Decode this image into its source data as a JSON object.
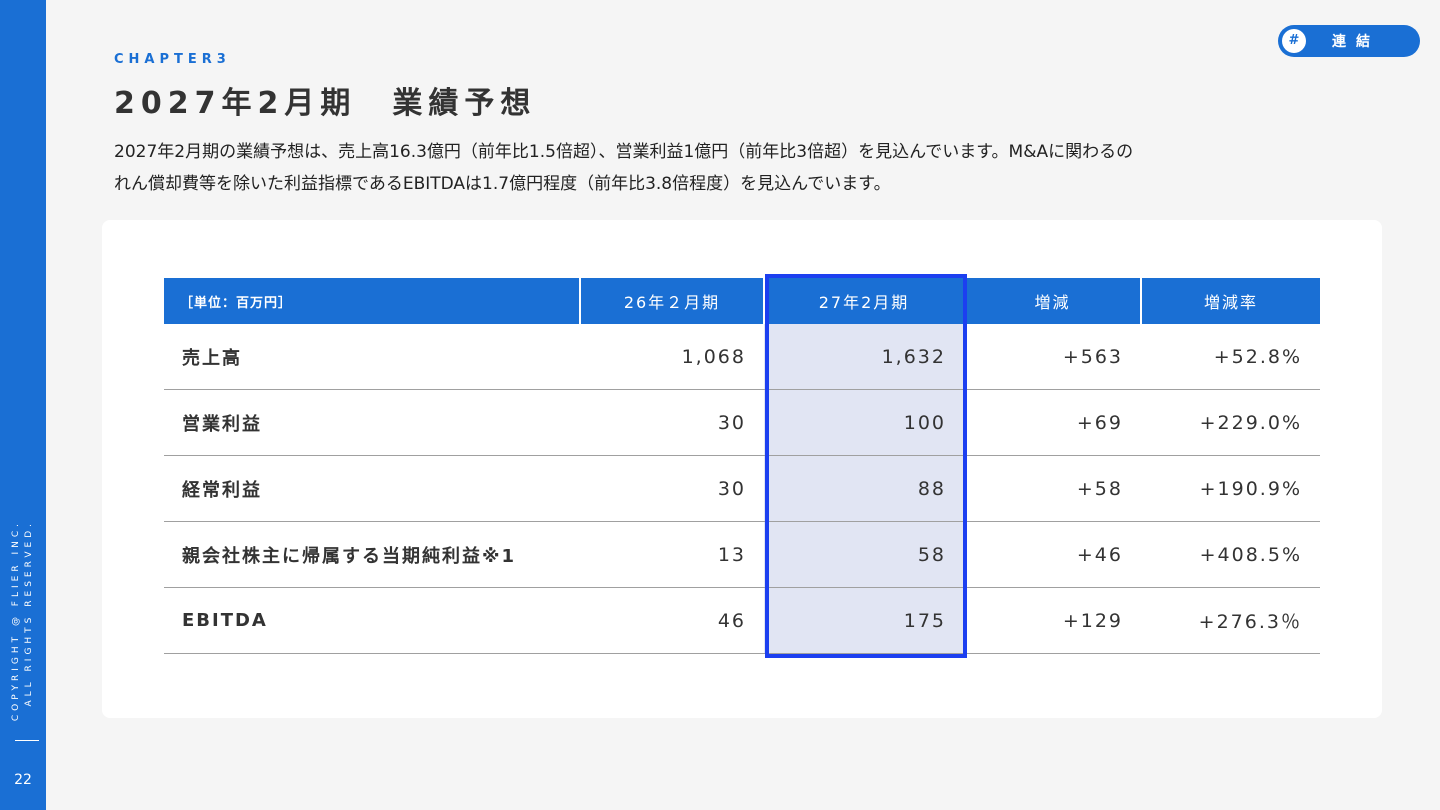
{
  "sidebar": {
    "copyright_line1": "COPYRIGHT @ FLIER INC.",
    "copyright_line2": "ALL RIGHTS RESERVED.",
    "page_number": "22"
  },
  "tag": {
    "hash": "#",
    "label": "連結"
  },
  "header": {
    "chapter": "CHAPTER3",
    "title": "2027年2月期　業績予想"
  },
  "description": {
    "line1": "2027年2月期の業績予想は、売上高16.3億円（前年比1.5倍超）、営業利益1億円（前年比3倍超）を見込んでいます。M&Aに関わるの",
    "line2": "れん償却費等を除いた利益指標であるEBITDAは1.7億円程度（前年比3.8倍程度）を見込んでいます。"
  },
  "table": {
    "headers": [
      "［単位：百万円］",
      "26年２月期",
      "27年2月期",
      "増減",
      "増減率"
    ],
    "rows": [
      {
        "label": "売上高",
        "fy26": "1,068",
        "fy27": "1,632",
        "change": "+563",
        "rate": "+52.8%"
      },
      {
        "label": "営業利益",
        "fy26": "30",
        "fy27": "100",
        "change": "+69",
        "rate": "+229.0%"
      },
      {
        "label": "経常利益",
        "fy26": "30",
        "fy27": "88",
        "change": "+58",
        "rate": "+190.9%"
      },
      {
        "label": "親会社株主に帰属する当期純利益※1",
        "fy26": "13",
        "fy27": "58",
        "change": "+46",
        "rate": "+408.5%"
      },
      {
        "label": "EBITDA",
        "fy26": "46",
        "fy27": "175",
        "change": "+129",
        "rate": "+276.3％"
      }
    ]
  },
  "colors": {
    "accent": "#1a6fd4",
    "highlight_fill": "#e1e5f3",
    "highlight_border": "#1c3ff0"
  }
}
